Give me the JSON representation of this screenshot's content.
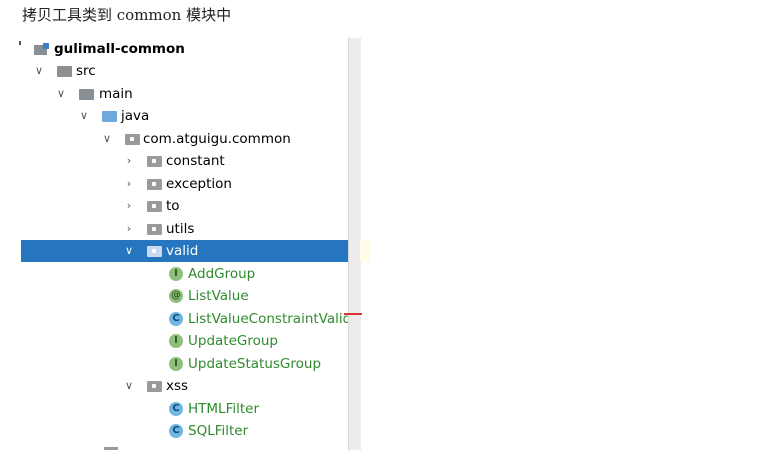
{
  "heading": "拷贝工具类到 common 模块中",
  "tree": {
    "module": "gulimall-common",
    "src": "src",
    "main": "main",
    "java": "java",
    "package": "com.atguigu.common",
    "subpackages": [
      "constant",
      "exception",
      "to",
      "utils"
    ],
    "selected_package": "valid",
    "valid_items": [
      {
        "label": "AddGroup",
        "kind": "interface",
        "glyph": "I"
      },
      {
        "label": "ListValue",
        "kind": "annotation",
        "glyph": "@"
      },
      {
        "label": "ListValueConstraintValidator",
        "kind": "class",
        "glyph": "C"
      },
      {
        "label": "UpdateGroup",
        "kind": "interface",
        "glyph": "I"
      },
      {
        "label": "UpdateStatusGroup",
        "kind": "interface",
        "glyph": "I"
      }
    ],
    "xss_package": "xss",
    "xss_items": [
      {
        "label": "HTMLFilter",
        "kind": "class",
        "glyph": "C"
      },
      {
        "label": "SQLFilter",
        "kind": "class",
        "glyph": "C"
      }
    ]
  },
  "icons": {
    "expanded": "chevron-down-icon",
    "collapsed": "chevron-right-icon",
    "folder": "folder-icon",
    "package": "package-icon",
    "module": "module-icon"
  },
  "colors": {
    "selection": "#2675bf",
    "class_text": "#2e8b2e"
  }
}
